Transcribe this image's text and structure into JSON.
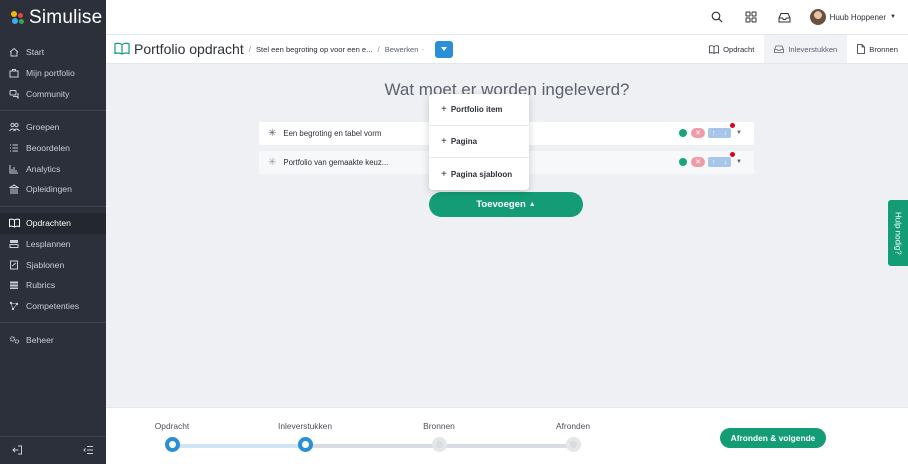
{
  "app": {
    "name": "Simulise"
  },
  "colors": {
    "accent_green": "#139c75",
    "accent_blue": "#2b8fd6",
    "sidebar_bg": "#2b303b",
    "status_green": "#18a57a",
    "danger_pink": "#ef9ca8",
    "notify_red": "#e3001b"
  },
  "sidebar": {
    "groups": [
      [
        {
          "label": "Start",
          "icon": "home-icon"
        },
        {
          "label": "Mijn portfolio",
          "icon": "portfolio-icon"
        },
        {
          "label": "Community",
          "icon": "chat-icon"
        }
      ],
      [
        {
          "label": "Groepen",
          "icon": "users-icon"
        },
        {
          "label": "Beoordelen",
          "icon": "list-check-icon"
        },
        {
          "label": "Analytics",
          "icon": "bar-chart-icon"
        },
        {
          "label": "Opleidingen",
          "icon": "institution-icon"
        }
      ],
      [
        {
          "label": "Opdrachten",
          "icon": "book-open-icon",
          "active": true
        },
        {
          "label": "Lesplannen",
          "icon": "layers-icon"
        },
        {
          "label": "Sjablonen",
          "icon": "template-icon"
        },
        {
          "label": "Rubrics",
          "icon": "table-icon"
        },
        {
          "label": "Competenties",
          "icon": "network-icon"
        }
      ],
      [
        {
          "label": "Beheer",
          "icon": "gears-icon"
        }
      ]
    ]
  },
  "topbar": {
    "user_name": "Huub Hoppener"
  },
  "header": {
    "title": "Portfolio opdracht",
    "breadcrumb": [
      "Stel een begroting op voor een e...",
      "Bewerken"
    ],
    "tabs": [
      {
        "label": "Opdracht",
        "icon": "book-open-icon"
      },
      {
        "label": "Inleverstukken",
        "icon": "inbox-icon",
        "active": true
      },
      {
        "label": "Bronnen",
        "icon": "file-icon"
      }
    ]
  },
  "main": {
    "heading": "Wat moet er worden ingeleverd?",
    "items": [
      {
        "label": "Een begroting en tabel vorm"
      },
      {
        "label": "Portfolio van gemaakte keuz..."
      }
    ],
    "add_button": "Toevoegen",
    "add_menu": [
      {
        "label": "Portfolio item"
      },
      {
        "label": "Pagina"
      },
      {
        "label": "Pagina sjabloon"
      }
    ]
  },
  "help": {
    "label": "Hulp nodig?"
  },
  "footer": {
    "steps": [
      {
        "label": "Opdracht",
        "done": true
      },
      {
        "label": "Inleverstukken",
        "done": true
      },
      {
        "label": "Bronnen",
        "done": false
      },
      {
        "label": "Afronden",
        "done": false
      }
    ],
    "finish_button": "Afronden & volgende"
  }
}
